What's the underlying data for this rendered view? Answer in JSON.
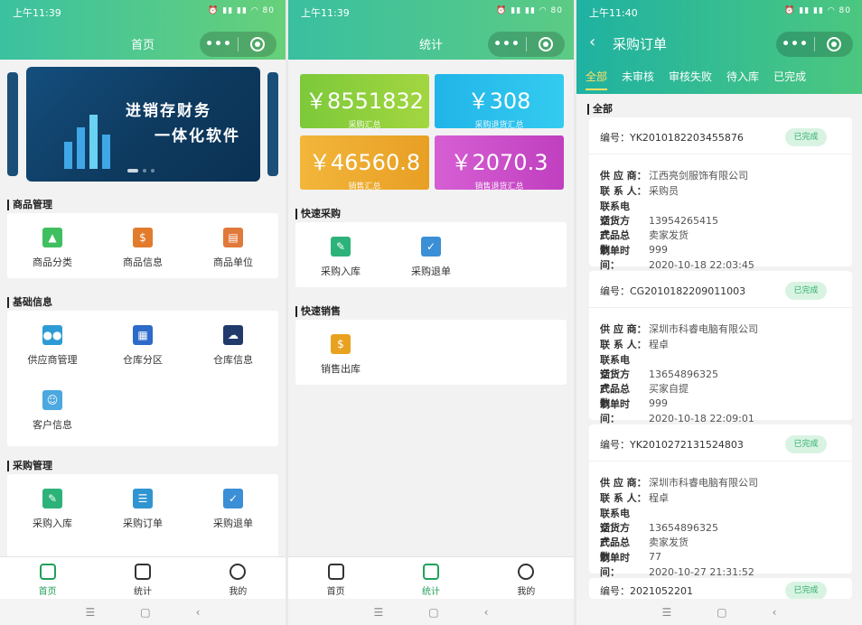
{
  "status": {
    "p1_time": "上午11:39",
    "p2_time": "上午11:39",
    "p3_time": "上午11:40",
    "battery": "80"
  },
  "screen1": {
    "title": "首页",
    "banner": {
      "line1": "进销存财务",
      "line2": "一体化软件"
    },
    "sections": [
      {
        "title": "商品管理",
        "items": [
          {
            "label": "商品分类",
            "icon": "bag-icon",
            "color": "#3fbf5f"
          },
          {
            "label": "商品信息",
            "icon": "money-doc-icon",
            "color": "#e27b2b"
          },
          {
            "label": "商品单位",
            "icon": "unit-icon",
            "color": "#e0793a"
          }
        ]
      },
      {
        "title": "基础信息",
        "items": [
          {
            "label": "供应商管理",
            "icon": "people-icon",
            "color": "#2e9bd6"
          },
          {
            "label": "仓库分区",
            "icon": "board-icon",
            "color": "#2d6ac9"
          },
          {
            "label": "仓库信息",
            "icon": "cloud-icon",
            "color": "#213a6b"
          },
          {
            "label": "客户信息",
            "icon": "contact-icon",
            "color": "#4ba8e0"
          }
        ]
      },
      {
        "title": "采购管理",
        "items": [
          {
            "label": "采购入库",
            "icon": "pen-icon",
            "color": "#2db37a"
          },
          {
            "label": "采购订单",
            "icon": "list-icon",
            "color": "#2f95d1"
          },
          {
            "label": "采购退单",
            "icon": "check-bag-icon",
            "color": "#3a8fd6"
          }
        ]
      }
    ],
    "tabs": [
      "首页",
      "统计",
      "我的"
    ]
  },
  "screen2": {
    "title": "统计",
    "stats": [
      {
        "value": "￥8551832",
        "label": "采购汇总",
        "color": "#8fcf38"
      },
      {
        "value": "￥308",
        "label": "采购退货汇总",
        "color": "#29c3ea"
      },
      {
        "value": "￥46560.8",
        "label": "销售汇总",
        "color": "#efb033"
      },
      {
        "value": "￥2070.3",
        "label": "销售退货汇总",
        "color": "#c94fc7"
      }
    ],
    "quick_purchase": {
      "title": "快速采购",
      "items": [
        {
          "label": "采购入库",
          "icon": "pen-icon",
          "color": "#2db37a"
        },
        {
          "label": "采购退单",
          "icon": "check-bag-icon",
          "color": "#3a8fd6"
        }
      ]
    },
    "quick_sales": {
      "title": "快速销售",
      "items": [
        {
          "label": "销售出库",
          "icon": "money-doc-icon",
          "color": "#e8a21f"
        }
      ]
    },
    "tabs": [
      "首页",
      "统计",
      "我的"
    ]
  },
  "screen3": {
    "title": "采购订单",
    "tabs": [
      "全部",
      "未审核",
      "审核失败",
      "待入库",
      "已完成"
    ],
    "section_title": "全部",
    "field_labels": {
      "supplier": "供 应 商：",
      "contact": "联 系 人：",
      "phone": "联系电话：",
      "delivery": "交货方式：",
      "total": "产品总数：",
      "time": "制单时间："
    },
    "orders": [
      {
        "no": "编号：YK2010182203455876",
        "status": "已完成",
        "supplier": "江西亮剑服饰有限公司",
        "contact": "采购员",
        "phone": "13954265415",
        "delivery": "卖家发货",
        "total": "999",
        "time": "2020-10-18 22:03:45"
      },
      {
        "no": "编号：CG2010182209011003",
        "status": "已完成",
        "supplier": "深圳市科睿电脑有限公司",
        "contact": "程卓",
        "phone": "13654896325",
        "delivery": "买家自提",
        "total": "999",
        "time": "2020-10-18 22:09:01"
      },
      {
        "no": "编号：YK2010272131524803",
        "status": "已完成",
        "supplier": "深圳市科睿电脑有限公司",
        "contact": "程卓",
        "phone": "13654896325",
        "delivery": "卖家发货",
        "total": "77",
        "time": "2020-10-27 21:31:52"
      },
      {
        "no": "编号：2021052201",
        "status": "已完成"
      }
    ]
  }
}
